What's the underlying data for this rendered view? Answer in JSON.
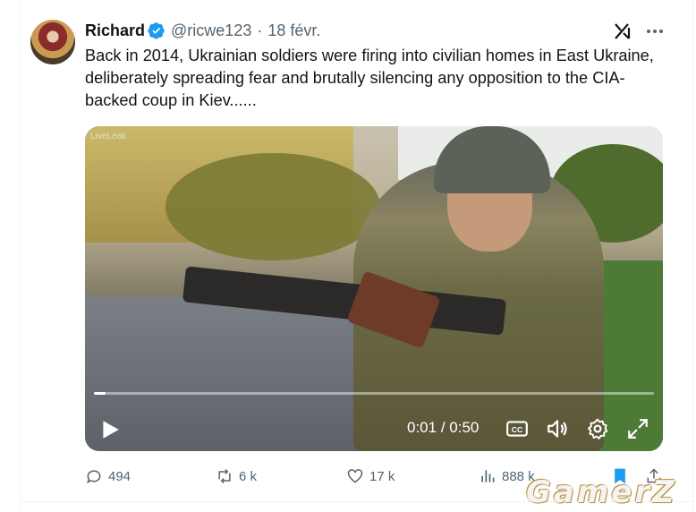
{
  "tweet": {
    "author_name": "Richard",
    "handle": "@ricwe123",
    "separator": "·",
    "date": "18 févr.",
    "text": "Back in 2014, Ukrainian soldiers were firing into civilian homes in East Ukraine, deliberately spreading fear and brutally silencing any opposition to the CIA-backed coup in Kiev......"
  },
  "video": {
    "current_time": "0:01",
    "time_separator": " / ",
    "duration": "0:50",
    "progress": 0.02,
    "overlay_tag": "LiveLeak"
  },
  "actions": {
    "replies": "494",
    "reposts": "6 k",
    "likes": "17 k",
    "views": "888 k"
  },
  "colors": {
    "verified": "#1d9bf0",
    "bookmark_active": "#1d9bf0",
    "muted_text": "#536471"
  },
  "icons": [
    "verified-badge-icon",
    "grok-icon",
    "more-icon",
    "play-icon",
    "captions-icon",
    "volume-icon",
    "settings-icon",
    "fullscreen-icon",
    "reply-icon",
    "repost-icon",
    "like-icon",
    "views-icon",
    "bookmark-icon",
    "share-icon"
  ],
  "watermark": "GamerZ"
}
